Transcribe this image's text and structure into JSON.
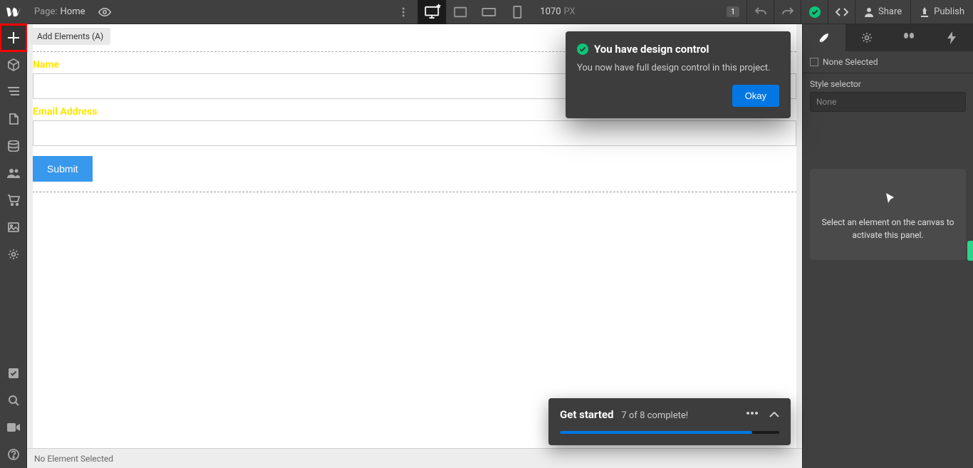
{
  "topbar": {
    "page_label": "Page:",
    "page_name": "Home",
    "breakpoint_width": "1070",
    "breakpoint_unit": "PX",
    "notif_count": "1",
    "share_label": "Share",
    "publish_label": "Publish"
  },
  "leftrail": {
    "add_tooltip": "Add Elements (A)"
  },
  "canvas": {
    "form": {
      "name_label": "Name",
      "email_label": "Email Address",
      "submit_label": "Submit"
    },
    "status_text": "No Element Selected"
  },
  "rightpanel": {
    "none_selected": "None Selected",
    "style_selector_label": "Style selector",
    "selector_placeholder": "None",
    "empty_hint": "Select an element on the canvas to activate this panel."
  },
  "popover": {
    "title": "You have design control",
    "body": "You now have full design control in this project.",
    "okay": "Okay"
  },
  "getstarted": {
    "title": "Get started",
    "progress_text": "7 of 8 complete!",
    "progress_pct": 87.5
  }
}
